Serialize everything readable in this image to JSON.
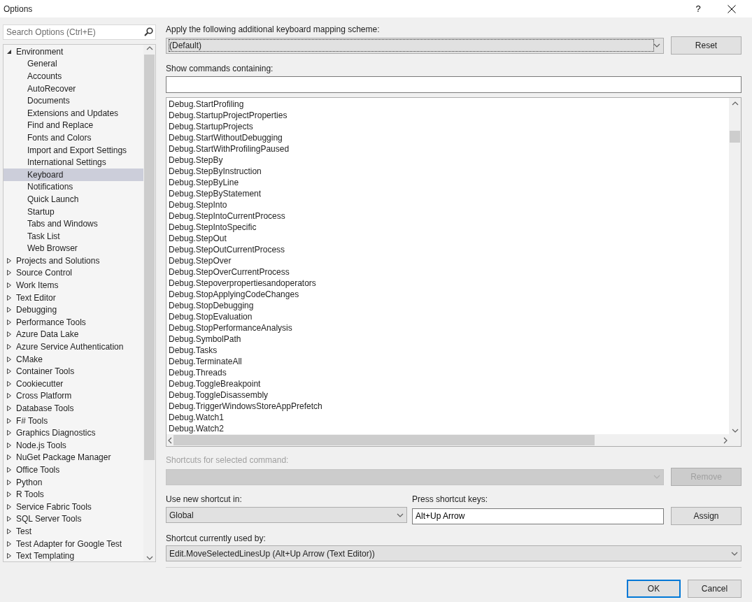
{
  "window": {
    "title": "Options",
    "help": "?"
  },
  "sidebar": {
    "search": {
      "placeholder": "Search Options (Ctrl+E)"
    },
    "tree": [
      {
        "label": "Environment",
        "expanded": true,
        "selected": false,
        "children": [
          {
            "label": "General",
            "selected": false
          },
          {
            "label": "Accounts",
            "selected": false
          },
          {
            "label": "AutoRecover",
            "selected": false
          },
          {
            "label": "Documents",
            "selected": false
          },
          {
            "label": "Extensions and Updates",
            "selected": false
          },
          {
            "label": "Find and Replace",
            "selected": false
          },
          {
            "label": "Fonts and Colors",
            "selected": false
          },
          {
            "label": "Import and Export Settings",
            "selected": false
          },
          {
            "label": "International Settings",
            "selected": false
          },
          {
            "label": "Keyboard",
            "selected": true
          },
          {
            "label": "Notifications",
            "selected": false
          },
          {
            "label": "Quick Launch",
            "selected": false
          },
          {
            "label": "Startup",
            "selected": false
          },
          {
            "label": "Tabs and Windows",
            "selected": false
          },
          {
            "label": "Task List",
            "selected": false
          },
          {
            "label": "Web Browser",
            "selected": false
          }
        ]
      },
      {
        "label": "Projects and Solutions",
        "expanded": false,
        "selected": false
      },
      {
        "label": "Source Control",
        "expanded": false,
        "selected": false
      },
      {
        "label": "Work Items",
        "expanded": false,
        "selected": false
      },
      {
        "label": "Text Editor",
        "expanded": false,
        "selected": false
      },
      {
        "label": "Debugging",
        "expanded": false,
        "selected": false
      },
      {
        "label": "Performance Tools",
        "expanded": false,
        "selected": false
      },
      {
        "label": "Azure Data Lake",
        "expanded": false,
        "selected": false
      },
      {
        "label": "Azure Service Authentication",
        "expanded": false,
        "selected": false
      },
      {
        "label": "CMake",
        "expanded": false,
        "selected": false
      },
      {
        "label": "Container Tools",
        "expanded": false,
        "selected": false
      },
      {
        "label": "Cookiecutter",
        "expanded": false,
        "selected": false
      },
      {
        "label": "Cross Platform",
        "expanded": false,
        "selected": false
      },
      {
        "label": "Database Tools",
        "expanded": false,
        "selected": false
      },
      {
        "label": "F# Tools",
        "expanded": false,
        "selected": false
      },
      {
        "label": "Graphics Diagnostics",
        "expanded": false,
        "selected": false
      },
      {
        "label": "Node.js Tools",
        "expanded": false,
        "selected": false
      },
      {
        "label": "NuGet Package Manager",
        "expanded": false,
        "selected": false
      },
      {
        "label": "Office Tools",
        "expanded": false,
        "selected": false
      },
      {
        "label": "Python",
        "expanded": false,
        "selected": false
      },
      {
        "label": "R Tools",
        "expanded": false,
        "selected": false
      },
      {
        "label": "Service Fabric Tools",
        "expanded": false,
        "selected": false
      },
      {
        "label": "SQL Server Tools",
        "expanded": false,
        "selected": false
      },
      {
        "label": "Test",
        "expanded": false,
        "selected": false
      },
      {
        "label": "Test Adapter for Google Test",
        "expanded": false,
        "selected": false
      },
      {
        "label": "Text Templating",
        "expanded": false,
        "selected": false
      }
    ]
  },
  "mapping": {
    "label": "Apply the following additional keyboard mapping scheme:",
    "value": "(Default)",
    "button": "Reset"
  },
  "filter": {
    "label": "Show commands containing:"
  },
  "commands": [
    "Debug.StartProfiling",
    "Debug.StartupProjectProperties",
    "Debug.StartupProjects",
    "Debug.StartWithoutDebugging",
    "Debug.StartWithProfilingPaused",
    "Debug.StepBy",
    "Debug.StepByInstruction",
    "Debug.StepByLine",
    "Debug.StepByStatement",
    "Debug.StepInto",
    "Debug.StepIntoCurrentProcess",
    "Debug.StepIntoSpecific",
    "Debug.StepOut",
    "Debug.StepOutCurrentProcess",
    "Debug.StepOver",
    "Debug.StepOverCurrentProcess",
    "Debug.Stepoverpropertiesandoperators",
    "Debug.StopApplyingCodeChanges",
    "Debug.StopDebugging",
    "Debug.StopEvaluation",
    "Debug.StopPerformanceAnalysis",
    "Debug.SymbolPath",
    "Debug.Tasks",
    "Debug.TerminateAll",
    "Debug.Threads",
    "Debug.ToggleBreakpoint",
    "Debug.ToggleDisassembly",
    "Debug.TriggerWindowsStoreAppPrefetch",
    "Debug.Watch1",
    "Debug.Watch2"
  ],
  "shortcuts": {
    "label": "Shortcuts for selected command:",
    "disabled": true,
    "button": "Remove"
  },
  "use_in": {
    "label": "Use new shortcut in:",
    "value": "Global"
  },
  "press": {
    "label": "Press shortcut keys:",
    "value": "Alt+Up Arrow",
    "button": "Assign"
  },
  "used_by": {
    "label": "Shortcut currently used by:",
    "value": "Edit.MoveSelectedLinesUp (Alt+Up Arrow (Text Editor))"
  },
  "buttons": [
    {
      "label": "OK",
      "default": true
    },
    {
      "label": "Cancel",
      "default": false
    }
  ]
}
